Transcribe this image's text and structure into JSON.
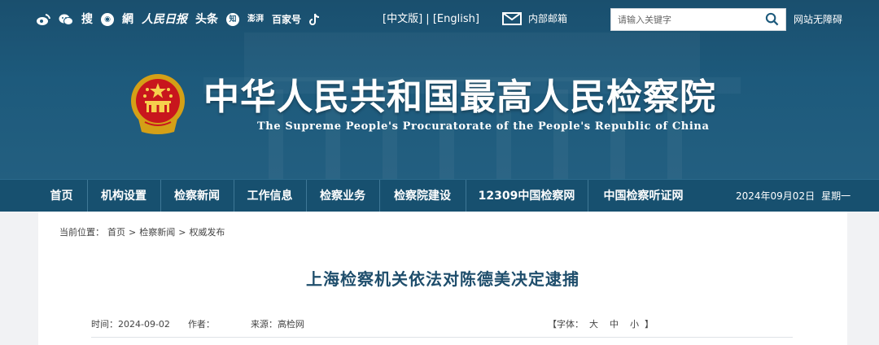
{
  "header": {
    "social_icons": [
      "weibo-icon",
      "wechat-icon",
      "sohu-icon",
      "toutiao-circle-icon",
      "netease-icon",
      "peoples-daily-icon",
      "toutiao-icon",
      "zhihu-icon",
      "penpai-icon",
      "baijiahao-icon",
      "douyin-icon"
    ],
    "social_labels": {
      "sohu": "搜",
      "netease": "網",
      "peoples_daily": "人民日报",
      "toutiao": "头条",
      "zhihu": "知",
      "penpai": "澎湃",
      "baijiahao": "百家号"
    },
    "lang_cn": "[中文版]",
    "lang_sep": " | ",
    "lang_en": "[English]",
    "mail_label": "内部邮箱",
    "search_placeholder": "请输入关键字",
    "accessibility": "网站无障碍",
    "title_cn": "中华人民共和国最高人民检察院",
    "title_en": "The Supreme People's Procuratorate of the People's Republic of China"
  },
  "nav": {
    "items": [
      {
        "label": "首页"
      },
      {
        "label": "机构设置"
      },
      {
        "label": "检察新闻"
      },
      {
        "label": "工作信息"
      },
      {
        "label": "检察业务"
      },
      {
        "label": "检察院建设"
      },
      {
        "label": "12309中国检察网"
      },
      {
        "label": "中国检察听证网"
      }
    ],
    "date": "2024年09月02日",
    "weekday": "星期一"
  },
  "article": {
    "breadcrumb_prefix": "当前位置：",
    "breadcrumb": [
      "首页",
      ">",
      "检察新闻",
      ">",
      "权威发布"
    ],
    "title": "上海检察机关依法对陈德美决定逮捕",
    "time_label": "时间：",
    "time": "2024-09-02",
    "author_label": "作者：",
    "author": "",
    "source_label": "来源：",
    "source": "高检网",
    "font_label": "【字体：",
    "font_large": "大",
    "font_medium": "中",
    "font_small": "小",
    "font_close": "】"
  },
  "colors": {
    "header_bg": "#1d5a7c",
    "nav_bg": "#17506f",
    "title_color": "#1f4e6c",
    "page_bg": "#f1f2f4"
  }
}
